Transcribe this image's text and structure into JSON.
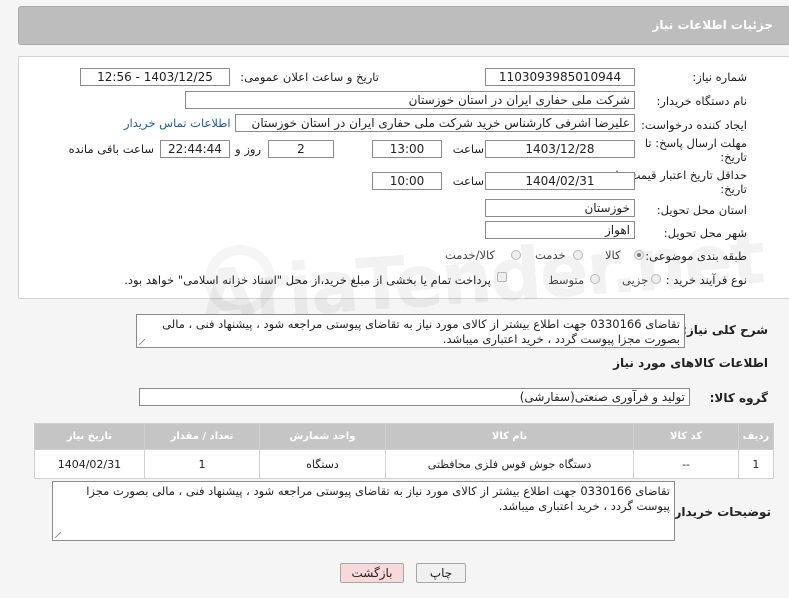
{
  "header": {
    "title": "جزئیات اطلاعات نیاز"
  },
  "form": {
    "need_number_label": "شماره نیاز:",
    "need_number": "1103093985010944",
    "announce_label": "تاریخ و ساعت اعلان عمومی:",
    "announce_value": "1403/12/25 - 12:56",
    "buyer_org_label": "نام دستگاه خریدار:",
    "buyer_org": "شرکت ملی حفاری ایران در استان خوزستان",
    "creator_label": "ایجاد کننده درخواست:",
    "creator": "علیرضا اشرفی کارشناس خرید شرکت ملی حفاری ایران در استان خوزستان",
    "contact_link": "اطلاعات تماس خریدار",
    "deadline_label_1": "مهلت ارسال پاسخ: تا",
    "deadline_label_2": "تاریخ:",
    "deadline_date": "1403/12/28",
    "time_word": "ساعت",
    "deadline_time": "13:00",
    "days": "2",
    "days_word": "روز و",
    "remaining": "22:44:44",
    "remaining_word": "ساعت باقی مانده",
    "validity_label_1": "حداقل تاریخ اعتبار قیمت: تا",
    "validity_label_2": "تاریخ:",
    "validity_date": "1404/02/31",
    "validity_time": "10:00",
    "province_label": "استان محل تحویل:",
    "province": "خوزستان",
    "city_label": "شهر محل تحویل:",
    "city": "اهواز",
    "category_label": "طبقه بندی موضوعی:",
    "category_options": [
      "کالا",
      "خدمت",
      "کالا/خدمت"
    ],
    "category_selected": "کالا",
    "process_label": "نوع فرآیند خرید :",
    "process_options": [
      "جزیی",
      "متوسط"
    ],
    "payment_note": "پرداخت تمام یا بخشی از مبلغ خرید،از محل \"اسناد خزانه اسلامی\" خواهد بود."
  },
  "description": {
    "label": "شرح کلی نیاز:",
    "text": "تقاضای 0330166 جهت اطلاع بیشتر از کالای مورد نیاز به تقاضای پیوستی مراجعه شود ، پیشنهاد فنی ، مالی بصورت مجزا پیوست گردد ، خرید اعتباری میباشد."
  },
  "goods": {
    "section_title": "اطلاعات کالاهای مورد نیاز",
    "group_label": "گروه کالا:",
    "group_value": "تولید و فرآوری صنعتی(سفارشی)",
    "columns": [
      "ردیف",
      "کد کالا",
      "نام کالا",
      "واحد شمارش",
      "تعداد / مقدار",
      "تاریخ نیاز"
    ],
    "rows": [
      {
        "row": "1",
        "code": "--",
        "name": "دستگاه جوش قوس فلزی محافظتی",
        "unit": "دستگاه",
        "qty": "1",
        "date": "1404/02/31"
      }
    ]
  },
  "buyer_notes": {
    "label": "توضیحات خریدار:",
    "text": "تقاضای 0330166 جهت اطلاع بیشتر از کالای مورد نیاز به تقاضای پیوستی مراجعه شود ، پیشنهاد فنی ، مالی بصورت مجزا پیوست گردد ، خرید اعتباری میباشد."
  },
  "buttons": {
    "print": "چاپ",
    "back": "بازگشت"
  },
  "colors": {
    "header_bg": "#bdbdbd",
    "link": "#1d5bb5",
    "back_button_bg": "#f7d9d9",
    "table_header_bg": "#c5c5c5"
  }
}
